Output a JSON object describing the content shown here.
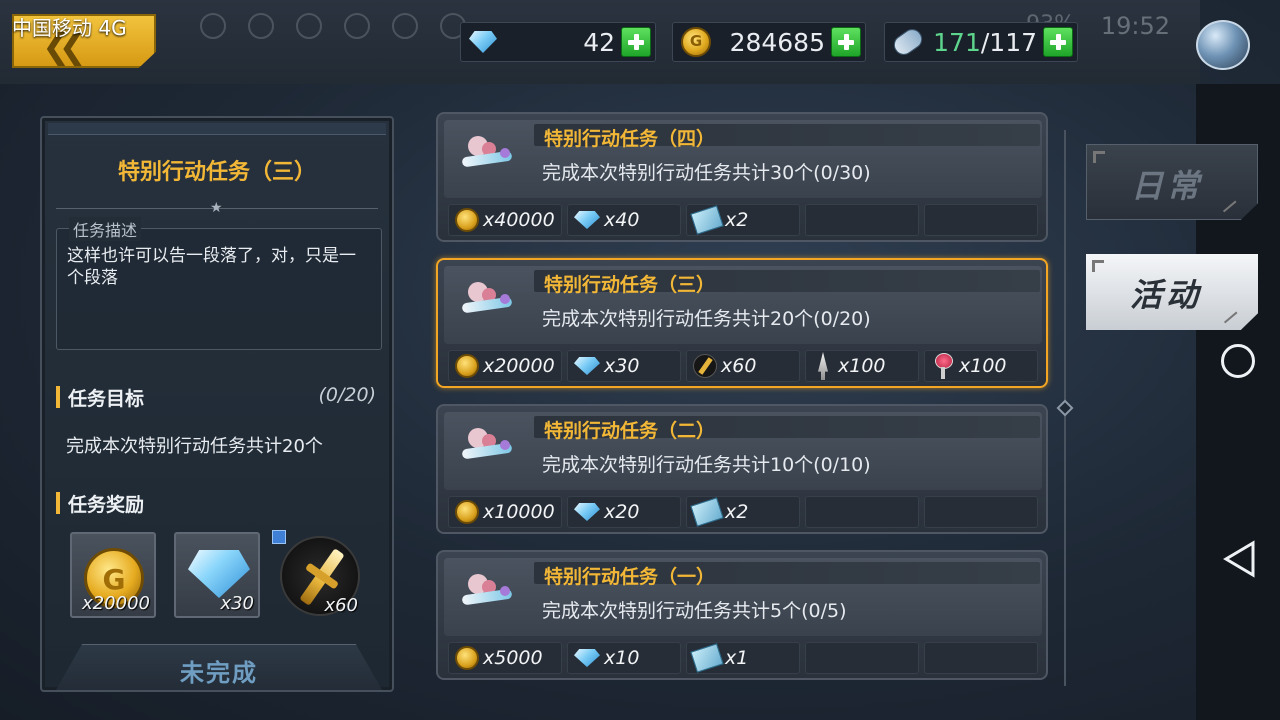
{
  "status_bar": {
    "carrier": "中国移动 4G",
    "battery": "93%",
    "time": "19:52"
  },
  "resources": {
    "gems": {
      "icon": "gem-icon",
      "value": "42"
    },
    "gold": {
      "icon": "coin-icon",
      "value": "284685"
    },
    "stamina": {
      "icon": "stamina-icon",
      "current": "171",
      "max": "/117"
    }
  },
  "detail": {
    "title": "特别行动任务（三）",
    "desc_label": "任务描述",
    "desc_text": "这样也许可以告一段落了，对，只是一个段落",
    "goal_label": "任务目标",
    "goal_progress": "(0/20)",
    "goal_text": "完成本次特别行动任务共计20个",
    "reward_label": "任务奖励",
    "rewards": [
      {
        "icon": "coin-icon",
        "qty": "x20000"
      },
      {
        "icon": "gem-icon",
        "qty": "x30"
      },
      {
        "icon": "sword-icon",
        "qty": "x60"
      }
    ],
    "status": "未完成"
  },
  "tasks": [
    {
      "title": "特别行动任务（四）",
      "desc": "完成本次特别行动任务共计30个(0/30)",
      "active": false,
      "rewards": [
        {
          "icon": "coin-icon",
          "qty": "x40000"
        },
        {
          "icon": "gem-icon",
          "qty": "x40"
        },
        {
          "icon": "ticket-icon",
          "qty": "x2"
        }
      ]
    },
    {
      "title": "特别行动任务（三）",
      "desc": "完成本次特别行动任务共计20个(0/20)",
      "active": true,
      "rewards": [
        {
          "icon": "coin-icon",
          "qty": "x20000"
        },
        {
          "icon": "gem-icon",
          "qty": "x30"
        },
        {
          "icon": "sword-icon",
          "qty": "x60"
        },
        {
          "icon": "dagger-icon",
          "qty": "x100"
        },
        {
          "icon": "trophy-icon",
          "qty": "x100"
        }
      ]
    },
    {
      "title": "特别行动任务（二）",
      "desc": "完成本次特别行动任务共计10个(0/10)",
      "active": false,
      "rewards": [
        {
          "icon": "coin-icon",
          "qty": "x10000"
        },
        {
          "icon": "gem-icon",
          "qty": "x20"
        },
        {
          "icon": "ticket-icon",
          "qty": "x2"
        }
      ]
    },
    {
      "title": "特别行动任务（一）",
      "desc": "完成本次特别行动任务共计5个(0/5)",
      "active": false,
      "rewards": [
        {
          "icon": "coin-icon",
          "qty": "x5000"
        },
        {
          "icon": "gem-icon",
          "qty": "x10"
        },
        {
          "icon": "ticket-icon",
          "qty": "x1"
        }
      ]
    }
  ],
  "tabs": {
    "daily": "日常",
    "activity": "活动",
    "selected": "activity"
  },
  "colors": {
    "accent": "#f2b736",
    "active_border": "#f2a623",
    "plus_green": "#2fbf3c"
  }
}
